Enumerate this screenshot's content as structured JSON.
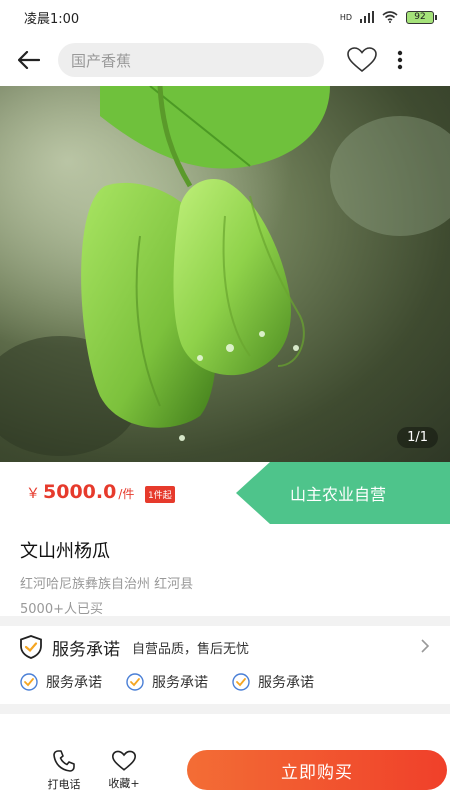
{
  "status": {
    "time": "凌晨1:00",
    "network": "HD",
    "battery": "92"
  },
  "search": {
    "placeholder": "国产香蕉"
  },
  "gallery": {
    "counter": "1/1",
    "image": "chayote-photo"
  },
  "product": {
    "currency": "￥",
    "price": "5000.0",
    "unit": "/件",
    "min_order": "1件起",
    "shop": "山主农业自营",
    "name": "文山州杨瓜",
    "origin": "红河哈尼族彝族自治州 红河县",
    "sold": "5000+人已买"
  },
  "service": {
    "title": "服务承诺",
    "desc": "自营品质，售后无忧",
    "items": [
      "服务承诺",
      "服务承诺",
      "服务承诺"
    ]
  },
  "bottom": {
    "call_label": "打电话",
    "fav_label": "收藏+",
    "buy_label": "立即购买"
  },
  "colors": {
    "price": "#e63a2c",
    "shop_banner": "#4ec48b",
    "buy_button": "#f0502c"
  }
}
